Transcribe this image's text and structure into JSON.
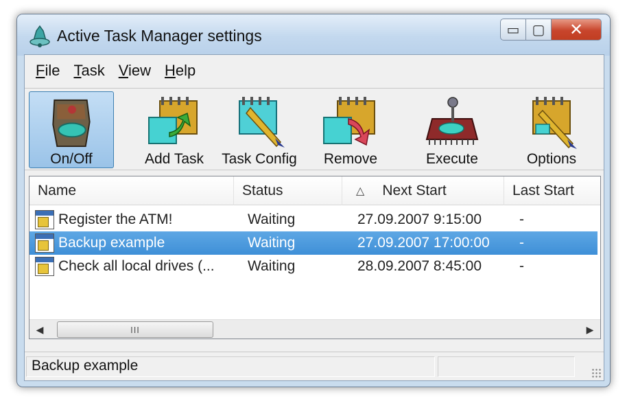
{
  "window": {
    "title": "Active Task Manager settings"
  },
  "title_buttons": {
    "minimize": "▭",
    "maximize": "▢",
    "close": "✕"
  },
  "menu": [
    {
      "label": "File",
      "access_key": "F",
      "rest": "ile"
    },
    {
      "label": "Task",
      "access_key": "T",
      "rest": "ask"
    },
    {
      "label": "View",
      "access_key": "V",
      "rest": "iew"
    },
    {
      "label": "Help",
      "access_key": "H",
      "rest": "elp"
    }
  ],
  "toolbar": {
    "buttons": [
      {
        "label": "On/Off",
        "icon": "on-off-icon",
        "active": true
      },
      {
        "label": "Add Task",
        "icon": "add-task-icon",
        "active": false
      },
      {
        "label": "Task Config",
        "icon": "task-config-icon",
        "active": false
      },
      {
        "label": "Remove",
        "icon": "remove-icon",
        "active": false
      },
      {
        "label": "Execute",
        "icon": "execute-icon",
        "active": false
      },
      {
        "label": "Options",
        "icon": "options-icon",
        "active": false
      }
    ]
  },
  "list": {
    "columns": [
      "Name",
      "Status",
      "Next Start",
      "Last Start"
    ],
    "sort_indicator": "△",
    "rows": [
      {
        "name": "Register the ATM!",
        "status": "Waiting",
        "next_start": "27.09.2007 9:15:00",
        "last_start": "-",
        "selected": false
      },
      {
        "name": "Backup example",
        "status": "Waiting",
        "next_start": "27.09.2007 17:00:00",
        "last_start": "-",
        "selected": true
      },
      {
        "name": "Check all local drives (...",
        "status": "Waiting",
        "next_start": "28.09.2007 8:45:00",
        "last_start": "-",
        "selected": false
      }
    ]
  },
  "scrollbar": {
    "thumb_grip": "III",
    "left_arrow": "◀",
    "right_arrow": "▶"
  },
  "statusbar": {
    "text": "Backup example"
  },
  "colors": {
    "selection": "#3e8fd7",
    "close_button": "#c8452c",
    "titlebar": "#c3d8ee"
  }
}
